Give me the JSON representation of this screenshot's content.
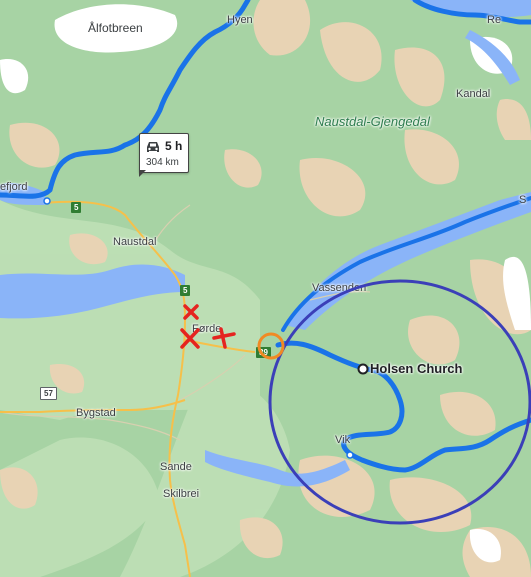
{
  "map": {
    "places": {
      "alfotbreen": "Ålfotbreen",
      "hyen": "Hyen",
      "re": "Re",
      "kandal": "Kandal",
      "naustdal_gjengedal": "Naustdal-Gjengedal",
      "efjord": "efjord",
      "naustdal": "Naustdal",
      "forde": "Førde",
      "vassenden": "Vassenden",
      "holsen_church": "Holsen Church",
      "bygstad": "Bygstad",
      "vik": "Vik",
      "sande": "Sande",
      "skilbrei": "Skilbrei",
      "s_edge": "S"
    },
    "route_shields": {
      "r5_north": "5",
      "r5_south": "5",
      "r39": "39",
      "r57": "57"
    },
    "route_callout": {
      "duration": "5 h",
      "distance": "304 km",
      "icon": "car-icon"
    },
    "colors": {
      "route": "#1a73e8",
      "water": "#8ab4f8",
      "land": "#a7d3a4",
      "mountain": "#e8d3b4",
      "glacier": "#ffffff",
      "major_road": "#f6c04a",
      "annotation_circle": "#3b3fb8",
      "annotation_marker_circle": "#f08a24",
      "annotation_cross": "#e52420"
    },
    "annotations": {
      "crosses": 3,
      "circles": 2
    }
  }
}
